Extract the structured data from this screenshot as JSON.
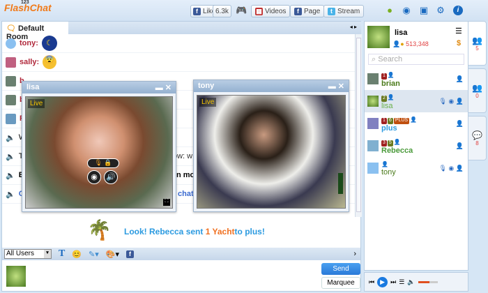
{
  "header": {
    "logo_top": "123",
    "logo": "FlashChat",
    "like": "Like",
    "like_count": "6.3k",
    "videos": "Videos",
    "page": "Page",
    "stream": "Stream",
    "icons": [
      "gamepad-icon",
      "apple-icon",
      "android-icon",
      "webcam-icon",
      "gift-icon",
      "gear-icon",
      "info-icon"
    ]
  },
  "room": {
    "tab": "Default Room"
  },
  "messages": [
    {
      "user": "tony:",
      "kind": "emoticon-moon"
    },
    {
      "user": "sally:",
      "kind": "emoticon-pray"
    },
    {
      "user": "b",
      "text": ""
    },
    {
      "user": "b",
      "text": ""
    },
    {
      "user": "R",
      "text": ""
    },
    {
      "system": "W",
      "tail": ""
    },
    {
      "system": "Th",
      "tail": "ow: w"
    },
    {
      "system": "Es",
      "tail": "n mor"
    },
    {
      "system": "Cl",
      "tail": "chat."
    }
  ],
  "cams": [
    {
      "name": "lisa",
      "live": "Live"
    },
    {
      "name": "tony",
      "live": "Live"
    }
  ],
  "gift": {
    "prefix": "Look! Rebecca sent ",
    "item": "1 Yacht",
    "suffix": " to plus!"
  },
  "toolbar": {
    "target": "All Users"
  },
  "input": {
    "send": "Send",
    "marquee": "Marquee"
  },
  "profile": {
    "name": "lisa",
    "coins": "513,348"
  },
  "search": {
    "placeholder": "Search"
  },
  "users": [
    {
      "name": "brian",
      "color": "#4a7a1a",
      "badges": [
        [
          "V",
          "1",
          "#a02020"
        ]
      ]
    },
    {
      "name": "lisa",
      "color": "#6ab04a",
      "badges": [
        [
          "✎",
          "2",
          "#6a7a20"
        ]
      ]
    },
    {
      "name": "plus",
      "color": "#2b9ae0",
      "badges": [
        [
          "V",
          "1",
          "#a02020"
        ],
        [
          "✎",
          "6",
          "#6a7a20"
        ],
        [
          "★",
          "PLUS",
          "#c05010"
        ]
      ]
    },
    {
      "name": "Rebecca",
      "color": "#4a9a3a",
      "badges": [
        [
          "V",
          "3",
          "#a02020"
        ],
        [
          "✎",
          "5",
          "#6a7a20"
        ]
      ]
    },
    {
      "name": "tony",
      "color": "#4a7a1a",
      "badges": []
    }
  ],
  "side_tabs": [
    {
      "count": "5"
    },
    {
      "count": "0"
    },
    {
      "count": "8"
    }
  ],
  "player": {
    "volume": 0.6
  }
}
